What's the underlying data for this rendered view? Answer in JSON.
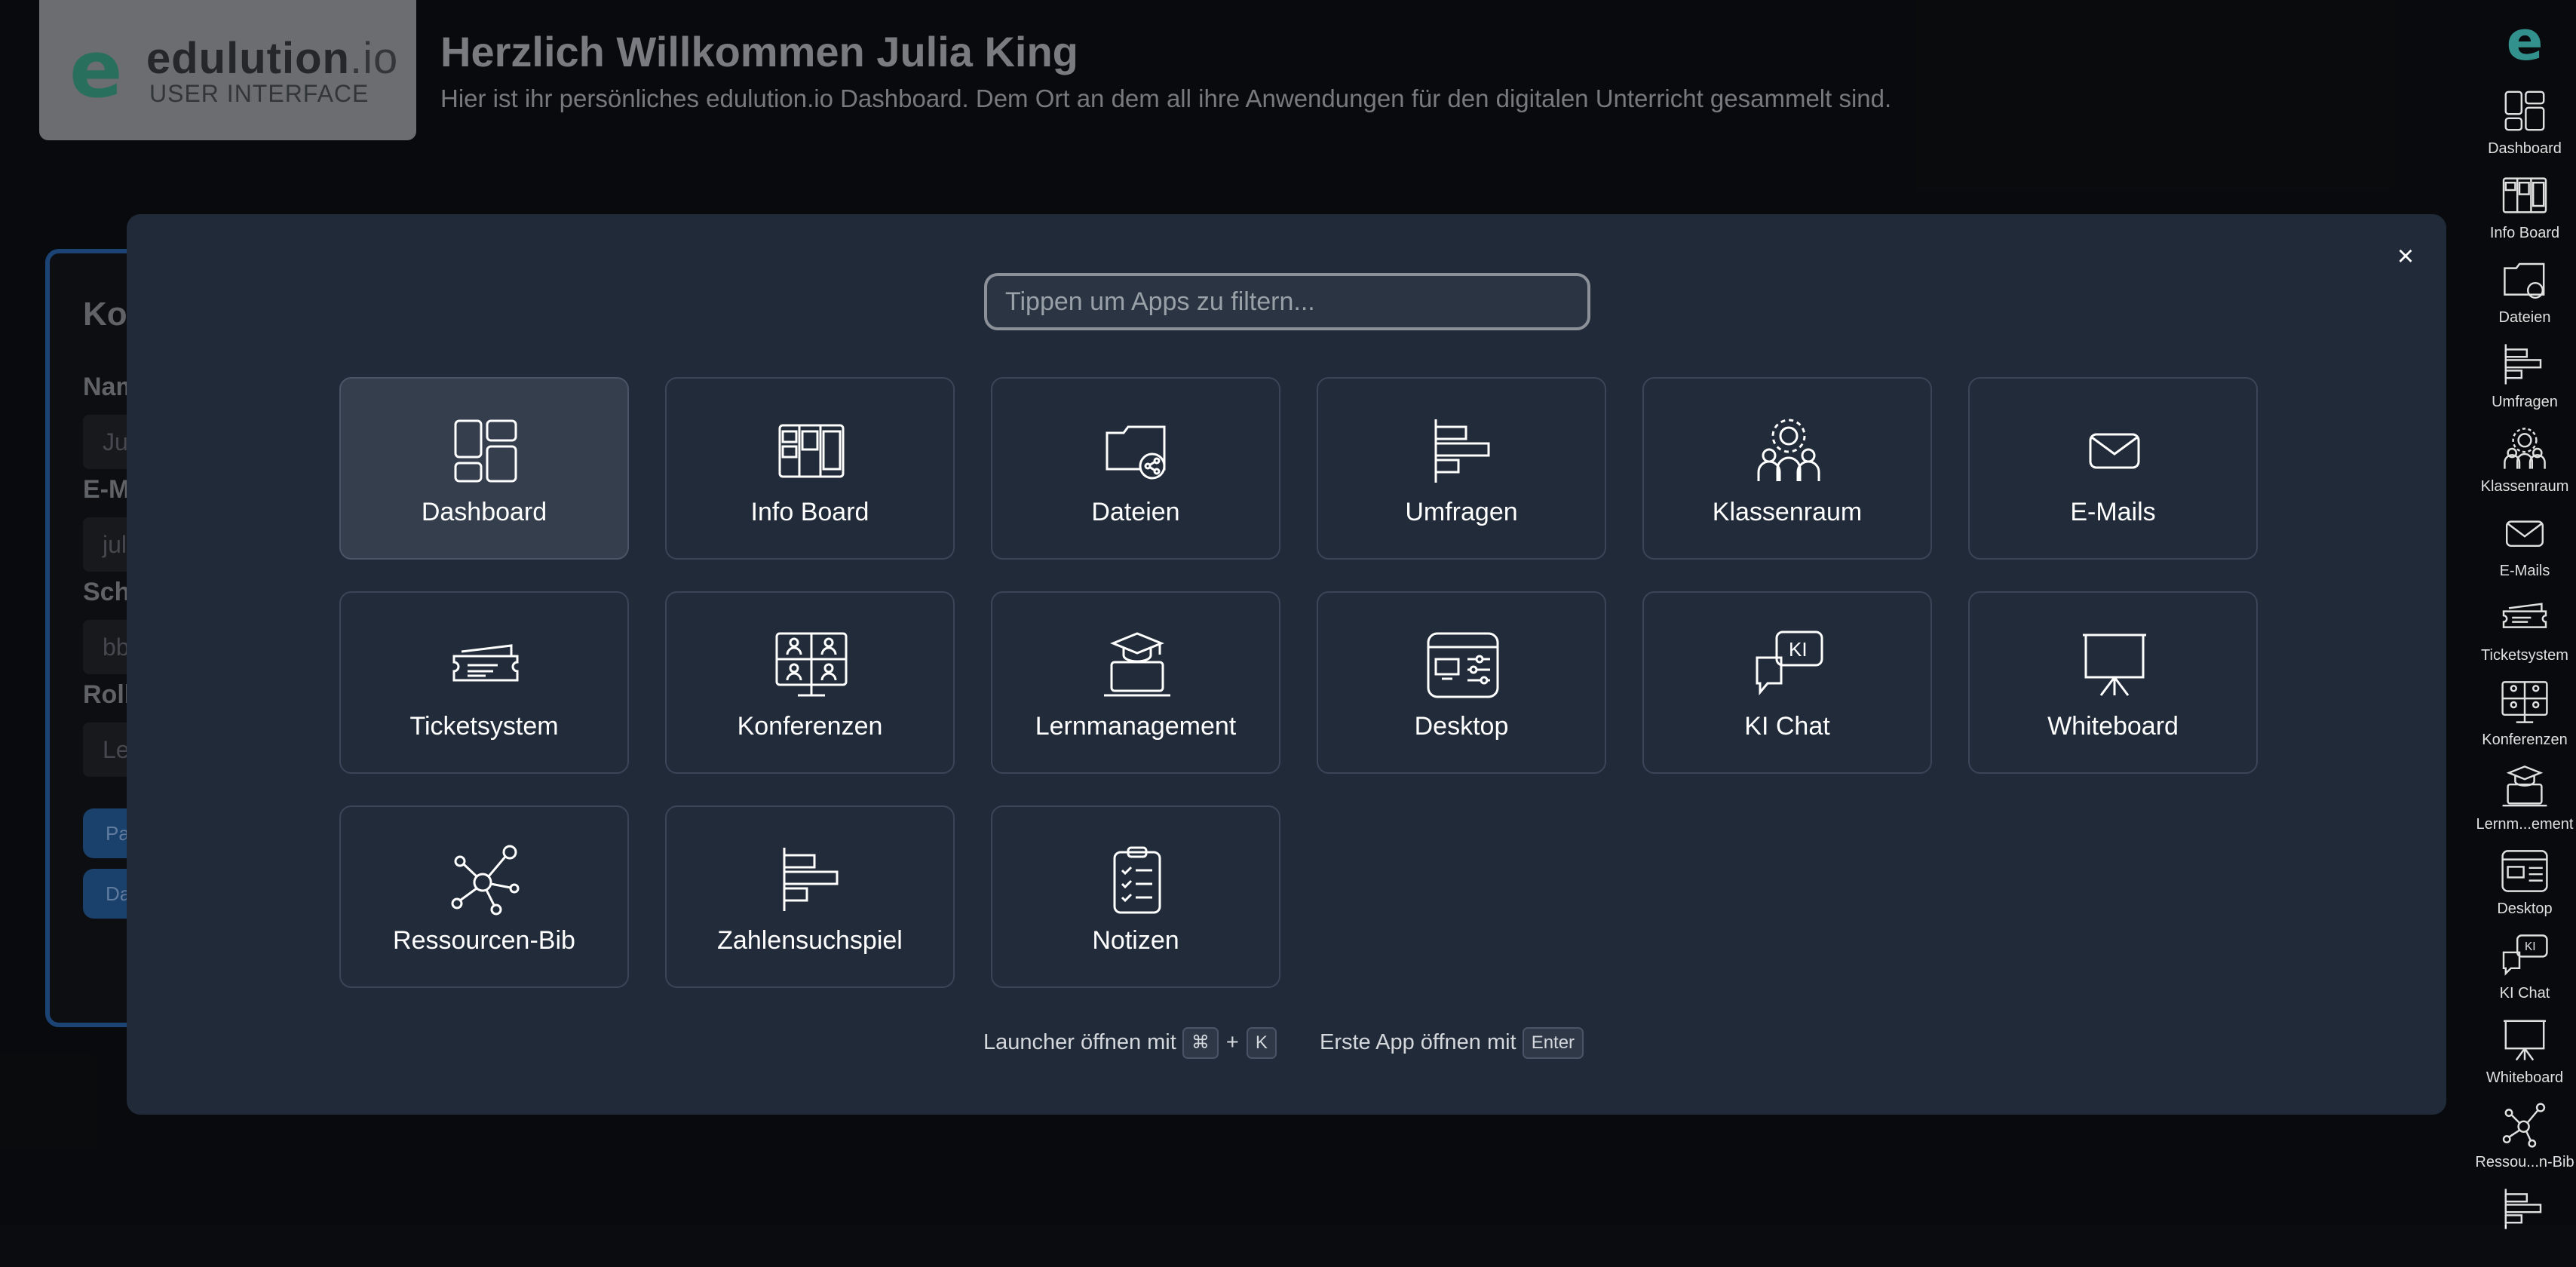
{
  "brand": {
    "word": "edulution",
    "suffix": ".io",
    "subtitle": "USER INTERFACE",
    "mark": "e"
  },
  "welcome": {
    "title": "Herzlich Willkommen Julia King",
    "subtitle": "Hier ist ihr persönliches edulution.io Dashboard. Dem Ort an dem all ihre Anwendungen für den digitalen Unterricht gesammelt sind."
  },
  "profile": {
    "title": "Ko",
    "fields": [
      {
        "label": "Nam",
        "value": "Ju"
      },
      {
        "label": "E-M",
        "value": "jul"
      },
      {
        "label": "Schu",
        "value": "bb"
      },
      {
        "label": "Roll",
        "value": "Le"
      }
    ],
    "buttons": [
      "Pa",
      "Da"
    ]
  },
  "launcher": {
    "search_placeholder": "Tippen um Apps zu filtern...",
    "close": "×",
    "apps": [
      {
        "label": "Dashboard",
        "icon": "dashboard-icon",
        "active": true
      },
      {
        "label": "Info Board",
        "icon": "info-board-icon"
      },
      {
        "label": "Dateien",
        "icon": "files-icon"
      },
      {
        "label": "Umfragen",
        "icon": "surveys-icon"
      },
      {
        "label": "Klassenraum",
        "icon": "classroom-icon"
      },
      {
        "label": "E-Mails",
        "icon": "mail-icon"
      },
      {
        "label": "Ticketsystem",
        "icon": "ticket-icon"
      },
      {
        "label": "Konferenzen",
        "icon": "conference-icon"
      },
      {
        "label": "Lernmanagement",
        "icon": "learning-icon"
      },
      {
        "label": "Desktop",
        "icon": "desktop-icon"
      },
      {
        "label": "KI Chat",
        "icon": "ai-chat-icon"
      },
      {
        "label": "Whiteboard",
        "icon": "whiteboard-icon"
      },
      {
        "label": "Ressourcen-Bib",
        "icon": "resources-icon"
      },
      {
        "label": "Zahlensuchspiel",
        "icon": "number-game-icon"
      },
      {
        "label": "Notizen",
        "icon": "notes-icon"
      }
    ],
    "hint_open": "Launcher öffnen mit",
    "key_cmd": "⌘",
    "key_plus": "+",
    "key_k": "K",
    "hint_first": "Erste App öffnen mit",
    "key_enter": "Enter"
  },
  "sidebar": {
    "items": [
      "Dashboard",
      "Info Board",
      "Dateien",
      "Umfragen",
      "Klassenraum",
      "E-Mails",
      "Ticketsystem",
      "Konferenzen",
      "Lernm...ement",
      "Desktop",
      "KI Chat",
      "Whiteboard",
      "Ressou...n-Bib"
    ]
  }
}
